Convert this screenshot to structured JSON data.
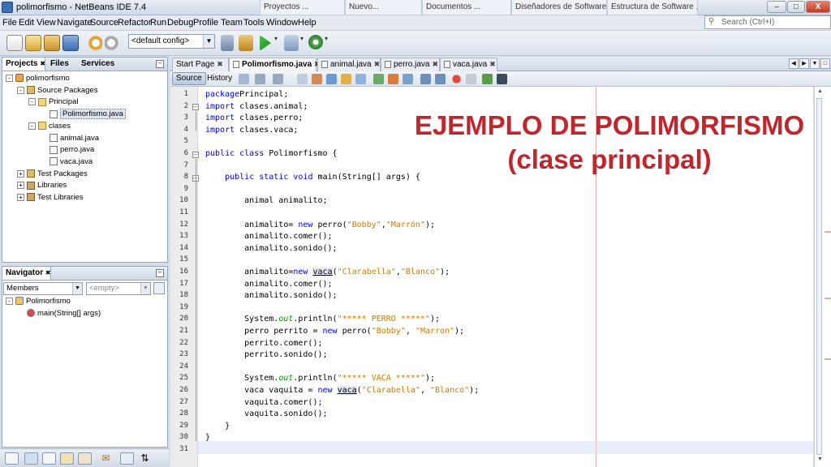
{
  "window": {
    "title": "polimorfismo - NetBeans IDE 7.4",
    "background_tabs": [
      "Proyectos ...",
      "Nuevo...",
      "Documentos ...",
      "Diseñadores de Software ...",
      "Estructura de Software ..."
    ],
    "minimize": "–",
    "maximize": "□",
    "close": "X"
  },
  "menu": [
    "File",
    "Edit",
    "View",
    "Navigate",
    "Source",
    "Refactor",
    "Run",
    "Debug",
    "Profile",
    "Team",
    "Tools",
    "Window",
    "Help"
  ],
  "search": {
    "placeholder": "Search (Ctrl+I)",
    "icon": "magnifier-icon"
  },
  "toolbar": {
    "config": "<default config>"
  },
  "projects_panel": {
    "tabs": [
      "Projects",
      "Files",
      "Services"
    ],
    "tree": [
      {
        "label": "polimorfismo",
        "icon": "project-icon",
        "indent": 0,
        "exp": "-"
      },
      {
        "label": "Source Packages",
        "icon": "source-packages-icon",
        "indent": 1,
        "exp": "-"
      },
      {
        "label": "Principal",
        "icon": "package-icon",
        "indent": 2,
        "exp": "-"
      },
      {
        "label": "Polimorfismo.java",
        "icon": "java-file-icon",
        "indent": 3,
        "exp": ""
      },
      {
        "label": "clases",
        "icon": "package-icon",
        "indent": 2,
        "exp": "-"
      },
      {
        "label": "animal.java",
        "icon": "java-file-icon",
        "indent": 3,
        "exp": ""
      },
      {
        "label": "perro.java",
        "icon": "java-file-icon",
        "indent": 3,
        "exp": ""
      },
      {
        "label": "vaca.java",
        "icon": "java-file-icon",
        "indent": 3,
        "exp": ""
      },
      {
        "label": "Test Packages",
        "icon": "test-packages-icon",
        "indent": 1,
        "exp": "+"
      },
      {
        "label": "Libraries",
        "icon": "libraries-icon",
        "indent": 1,
        "exp": "+"
      },
      {
        "label": "Test Libraries",
        "icon": "test-libraries-icon",
        "indent": 1,
        "exp": "+"
      }
    ]
  },
  "navigator": {
    "title": "Navigator",
    "members": "Members",
    "filter": "<empty>",
    "tree": [
      {
        "label": "Polimorfismo",
        "icon": "class-icon",
        "indent": 0
      },
      {
        "label": "main(String[] args)",
        "icon": "method-icon",
        "indent": 1
      }
    ]
  },
  "editor_tabs": [
    {
      "label": "Start Page",
      "active": false
    },
    {
      "label": "Polimorfismo.java",
      "active": true
    },
    {
      "label": "animal.java",
      "active": false
    },
    {
      "label": "perro.java",
      "active": false
    },
    {
      "label": "vaca.java",
      "active": false
    }
  ],
  "editor_toolbar": {
    "source": "Source",
    "history": "History"
  },
  "code": [
    {
      "n": "1",
      "t": [
        [
          "kw",
          "package"
        ],
        [
          "",
          "Principal;"
        ]
      ]
    },
    {
      "n": "2",
      "t": [
        [
          "kw",
          "import"
        ],
        [
          "",
          " clases.animal;"
        ]
      ]
    },
    {
      "n": "3",
      "t": [
        [
          "kw",
          "import"
        ],
        [
          "",
          " clases.perro;"
        ]
      ]
    },
    {
      "n": "4",
      "t": [
        [
          "kw",
          "import"
        ],
        [
          "",
          " clases.vaca;"
        ]
      ]
    },
    {
      "n": "5",
      "t": []
    },
    {
      "n": "6",
      "t": [
        [
          "kw",
          "public class"
        ],
        [
          "",
          " Polimorfismo {"
        ]
      ]
    },
    {
      "n": "7",
      "t": []
    },
    {
      "n": "8",
      "t": [
        [
          "",
          "    "
        ],
        [
          "kw",
          "public static void"
        ],
        [
          "",
          " main(String[] args) {"
        ]
      ]
    },
    {
      "n": "9",
      "t": []
    },
    {
      "n": "10",
      "t": [
        [
          "",
          "        animal animalito;"
        ]
      ]
    },
    {
      "n": "11",
      "t": []
    },
    {
      "n": "12",
      "t": [
        [
          "",
          "        animalito= "
        ],
        [
          "kw",
          "new"
        ],
        [
          "",
          " perro("
        ],
        [
          "str",
          "\"Bobby\""
        ],
        [
          "",
          ","
        ],
        [
          "str",
          "\"Marrón\""
        ],
        [
          "",
          ");"
        ]
      ]
    },
    {
      "n": "13",
      "t": [
        [
          "",
          "        animalito.comer();"
        ]
      ]
    },
    {
      "n": "14",
      "t": [
        [
          "",
          "        animalito.sonido();"
        ]
      ]
    },
    {
      "n": "15",
      "t": []
    },
    {
      "n": "16",
      "t": [
        [
          "",
          "        animalito="
        ],
        [
          "kw",
          "new"
        ],
        [
          "",
          " "
        ],
        [
          "hl",
          "vaca"
        ],
        [
          "",
          "("
        ],
        [
          "str",
          "\"Clarabella\""
        ],
        [
          "",
          ","
        ],
        [
          "str",
          "\"Blanco\""
        ],
        [
          "",
          ");"
        ]
      ]
    },
    {
      "n": "17",
      "t": [
        [
          "",
          "        animalito.comer();"
        ]
      ]
    },
    {
      "n": "18",
      "t": [
        [
          "",
          "        animalito.sonido();"
        ]
      ]
    },
    {
      "n": "19",
      "t": []
    },
    {
      "n": "20",
      "t": [
        [
          "",
          "        System."
        ],
        [
          "fld",
          "out"
        ],
        [
          "",
          ".println("
        ],
        [
          "str",
          "\"***** PERRO *****\""
        ],
        [
          "",
          ");"
        ]
      ]
    },
    {
      "n": "21",
      "t": [
        [
          "",
          "        perro perrito = "
        ],
        [
          "kw",
          "new"
        ],
        [
          "",
          " perro("
        ],
        [
          "str",
          "\"Bobby\""
        ],
        [
          "",
          ", "
        ],
        [
          "str",
          "\"Marron\""
        ],
        [
          "",
          ");"
        ]
      ]
    },
    {
      "n": "22",
      "t": [
        [
          "",
          "        perrito.comer();"
        ]
      ]
    },
    {
      "n": "23",
      "t": [
        [
          "",
          "        perrito.sonido();"
        ]
      ]
    },
    {
      "n": "24",
      "t": []
    },
    {
      "n": "25",
      "t": [
        [
          "",
          "        System."
        ],
        [
          "fld",
          "out"
        ],
        [
          "",
          ".println("
        ],
        [
          "str",
          "\"***** VACA *****\""
        ],
        [
          "",
          ");"
        ]
      ]
    },
    {
      "n": "26",
      "t": [
        [
          "",
          "        vaca vaquita = "
        ],
        [
          "kw",
          "new"
        ],
        [
          "",
          " "
        ],
        [
          "hl",
          "vaca"
        ],
        [
          "",
          "("
        ],
        [
          "str",
          "\"Clarabella\""
        ],
        [
          "",
          ", "
        ],
        [
          "str",
          "\"Blanco\""
        ],
        [
          "",
          ");"
        ]
      ]
    },
    {
      "n": "27",
      "t": [
        [
          "",
          "        vaquita.comer();"
        ]
      ]
    },
    {
      "n": "28",
      "t": [
        [
          "",
          "        vaquita.sonido();"
        ]
      ]
    },
    {
      "n": "29",
      "t": [
        [
          "",
          "    }"
        ]
      ]
    },
    {
      "n": "30",
      "t": [
        [
          "",
          "}"
        ]
      ]
    },
    {
      "n": "31",
      "t": []
    }
  ],
  "overlay": {
    "line1": "EJEMPLO DE POLIMORFISMO",
    "line2": "(clase principal)",
    "color": "#c0272d"
  },
  "colors": {
    "keyword": "#0000e6",
    "string": "#ce7b00",
    "field": "#009900"
  }
}
